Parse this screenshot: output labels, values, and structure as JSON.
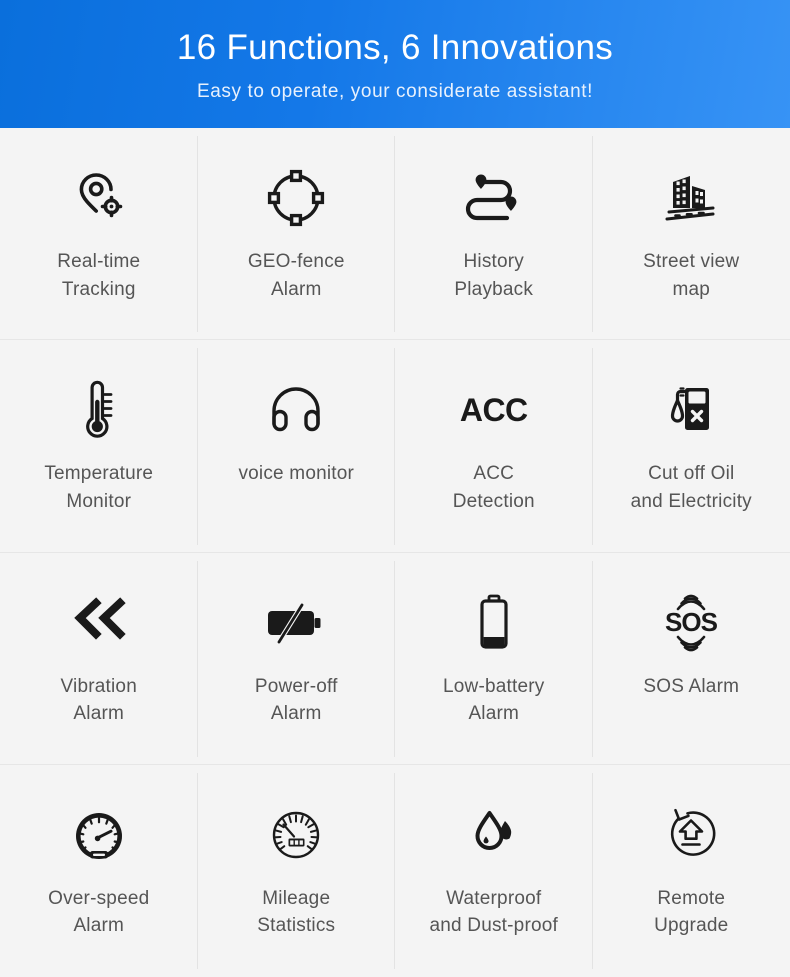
{
  "header": {
    "title": "16 Functions, 6 Innovations",
    "subtitle": "Easy to operate, your considerate assistant!",
    "gradient_start": "#0a6fdc",
    "gradient_end": "#3793f5",
    "title_color": "#ffffff",
    "subtitle_color": "#e8f1fd"
  },
  "theme": {
    "background": "#f4f4f4",
    "divider": "#e3e3e3",
    "icon_color": "#1a1a1a",
    "label_color": "#555555"
  },
  "features": [
    {
      "icon": "location-pin-target-icon",
      "label": "Real-time\nTracking"
    },
    {
      "icon": "geo-fence-circle-icon",
      "label": "GEO-fence\nAlarm"
    },
    {
      "icon": "route-path-icon",
      "label": "History\nPlayback"
    },
    {
      "icon": "street-buildings-icon",
      "label": "Street view\nmap"
    },
    {
      "icon": "thermometer-icon",
      "label": "Temperature\nMonitor"
    },
    {
      "icon": "headphones-icon",
      "label": "voice monitor"
    },
    {
      "icon": "acc-text-icon",
      "label": "ACC\nDetection",
      "icon_text": "ACC"
    },
    {
      "icon": "fuel-pump-cross-icon",
      "label": "Cut off Oil\nand Electricity"
    },
    {
      "icon": "vibration-chevrons-icon",
      "label": "Vibration\nAlarm"
    },
    {
      "icon": "battery-slash-icon",
      "label": "Power-off\nAlarm"
    },
    {
      "icon": "low-battery-icon",
      "label": "Low-battery\nAlarm"
    },
    {
      "icon": "sos-waves-icon",
      "label": "SOS Alarm",
      "icon_text": "SOS"
    },
    {
      "icon": "speedometer-icon",
      "label": "Over-speed\nAlarm"
    },
    {
      "icon": "odometer-icon",
      "label": "Mileage\nStatistics"
    },
    {
      "icon": "water-droplets-icon",
      "label": "Waterproof\nand Dust-proof"
    },
    {
      "icon": "remote-upgrade-icon",
      "label": "Remote\nUpgrade"
    }
  ]
}
